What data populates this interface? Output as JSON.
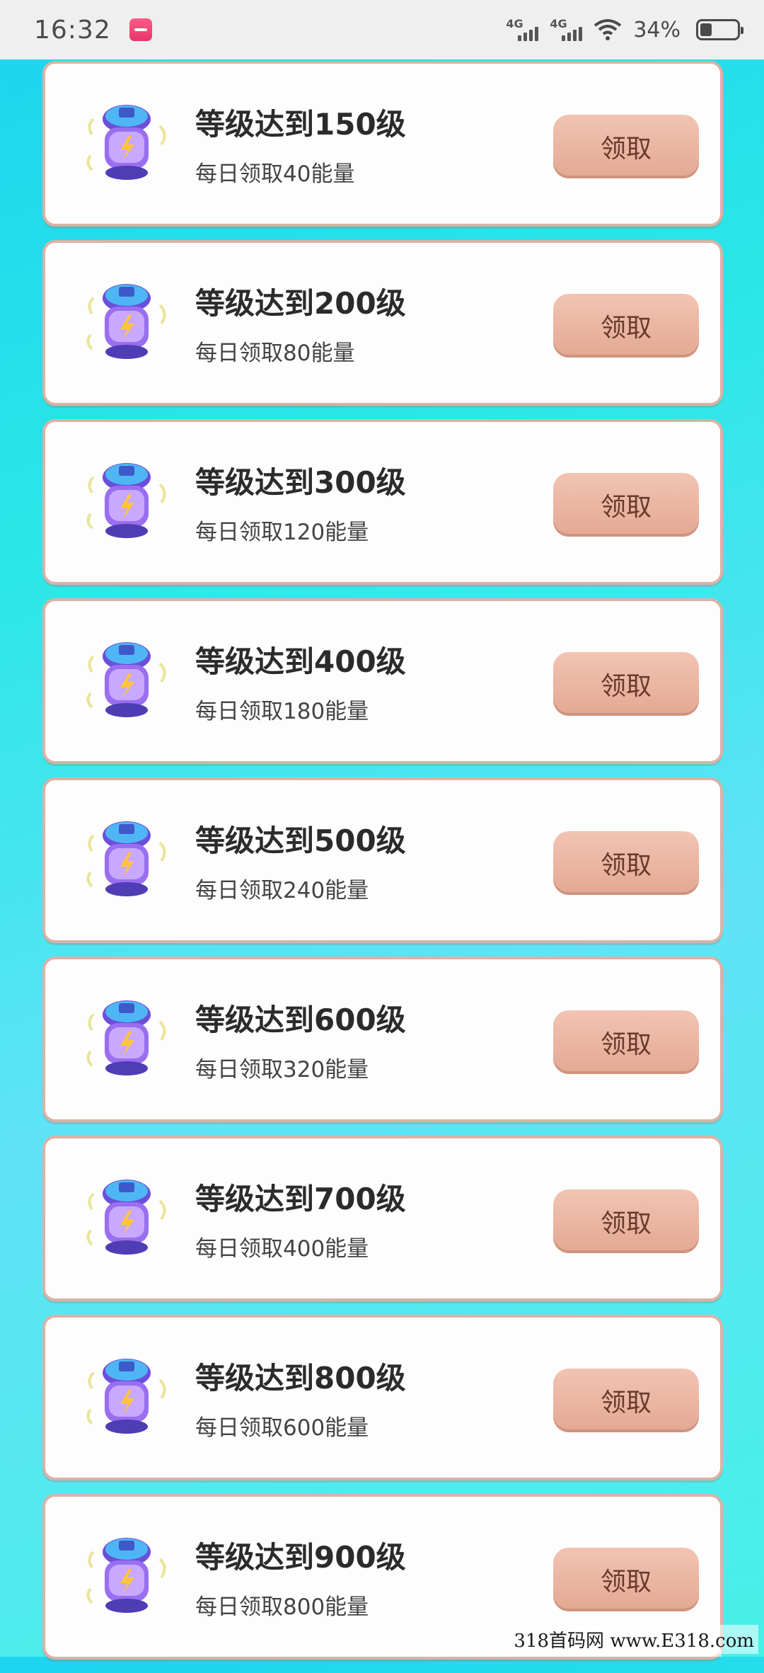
{
  "status_bar": {
    "time": "16:32",
    "network1": "4G",
    "network2": "4G",
    "battery_pct": "34%",
    "icons": [
      "app-notification-icon",
      "signal-icon",
      "wifi-icon",
      "battery-icon"
    ]
  },
  "rewards": [
    {
      "title": "等级达到150级",
      "subtitle": "每日领取40能量",
      "button": "领取"
    },
    {
      "title": "等级达到200级",
      "subtitle": "每日领取80能量",
      "button": "领取"
    },
    {
      "title": "等级达到300级",
      "subtitle": "每日领取120能量",
      "button": "领取"
    },
    {
      "title": "等级达到400级",
      "subtitle": "每日领取180能量",
      "button": "领取"
    },
    {
      "title": "等级达到500级",
      "subtitle": "每日领取240能量",
      "button": "领取"
    },
    {
      "title": "等级达到600级",
      "subtitle": "每日领取320能量",
      "button": "领取"
    },
    {
      "title": "等级达到700级",
      "subtitle": "每日领取400能量",
      "button": "领取"
    },
    {
      "title": "等级达到800级",
      "subtitle": "每日领取600能量",
      "button": "领取"
    },
    {
      "title": "等级达到900级",
      "subtitle": "每日领取800能量",
      "button": "领取"
    }
  ],
  "watermark": "318首码网 www.E318.com",
  "colors": {
    "card_border": "#d9b3a6",
    "button_bg": "#e9b39f",
    "button_text": "#6a3a2c",
    "background": "#2ce7e6"
  }
}
